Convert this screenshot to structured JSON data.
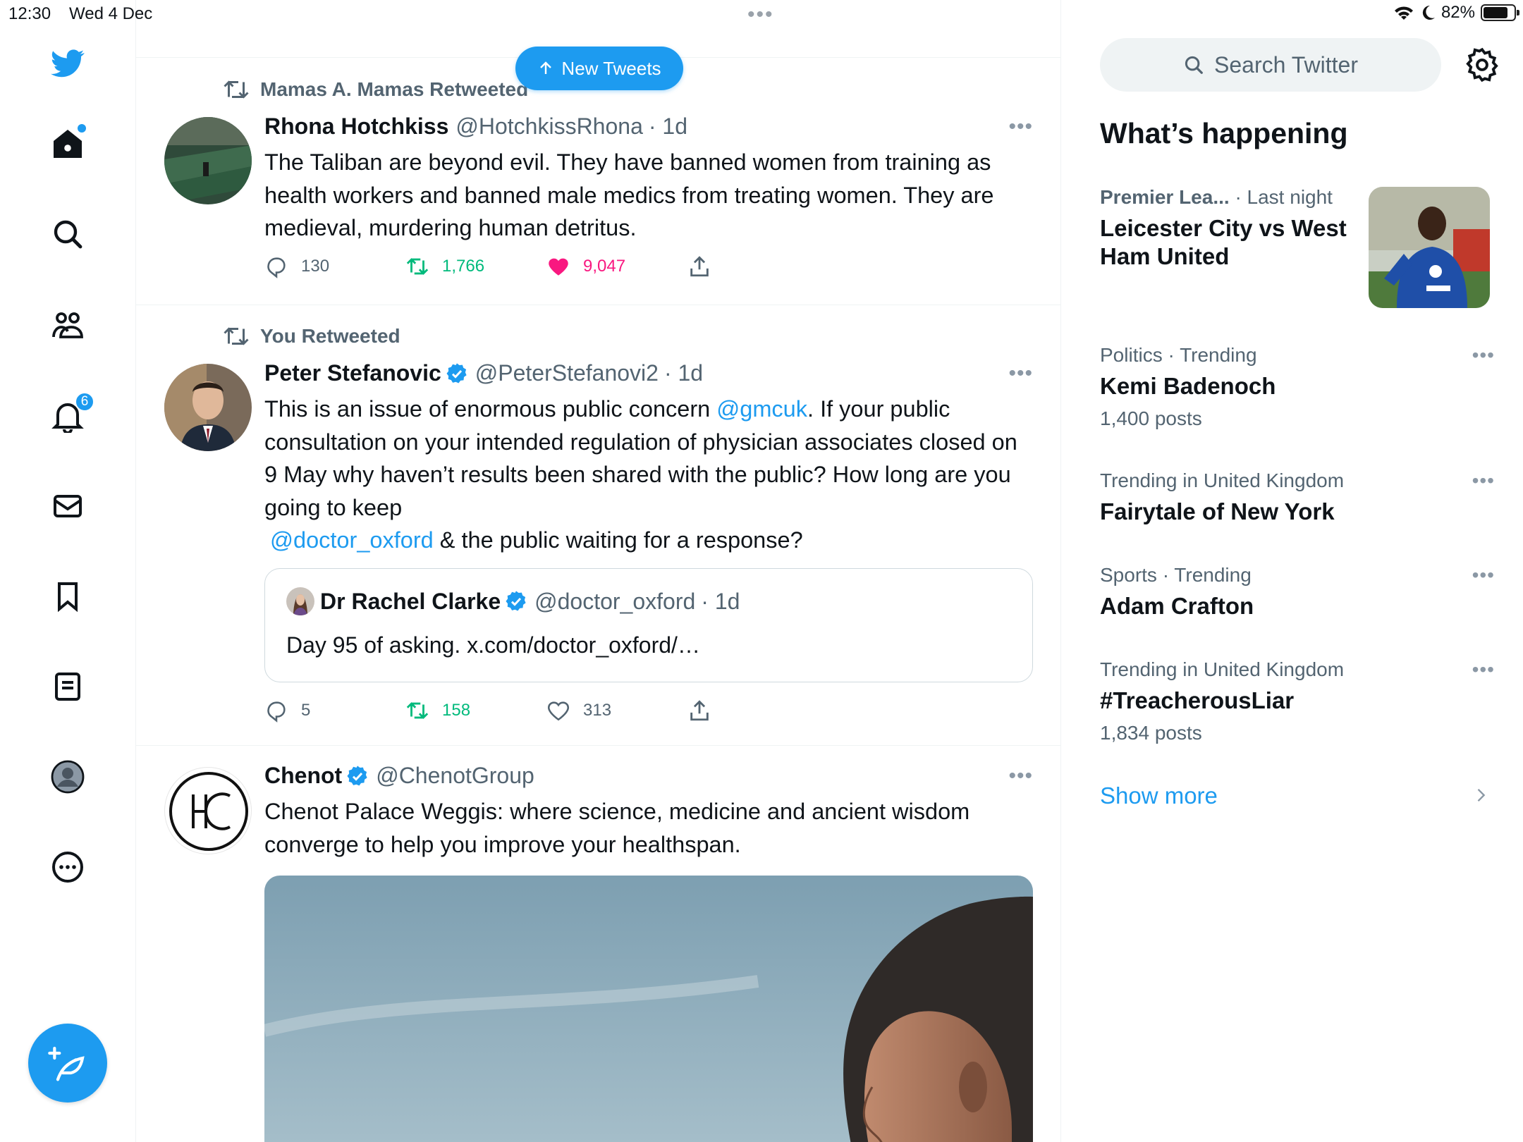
{
  "status_bar": {
    "time": "12:30",
    "date": "Wed 4 Dec",
    "battery": "82%",
    "battery_level": 0.82
  },
  "sidebar": {
    "items": [
      "twitter-logo",
      "home",
      "explore",
      "communities",
      "notifications",
      "messages",
      "bookmarks",
      "lists",
      "profile",
      "more"
    ],
    "notifications_badge": "6",
    "compose_label": "Tweet"
  },
  "timeline": {
    "new_tweets_label": "New Tweets",
    "tweets": [
      {
        "retweeted_by": "Mamas A. Mamas Retweeted",
        "name": "Rhona Hotchkiss",
        "handle": "@HotchkissRhona",
        "time": "· 1d",
        "text": "The Taliban are beyond evil. They have banned women from training as health workers and banned male medics from treating women. They are medieval, murdering human detritus.",
        "replies": "130",
        "retweets": "1,766",
        "likes": "9,047"
      },
      {
        "retweeted_by": "You Retweeted",
        "name": "Peter Stefanovic",
        "handle": "@PeterStefanovi2",
        "time": "· 1d",
        "text_before": "This is an issue of enormous public concern ",
        "mention1": "@gmcuk",
        "text_middle": ". If your public consultation on your intended regulation of physician associates closed on 9 May why haven’t results been shared with the public? How long are you going to keep",
        "mention2": "@doctor_oxford",
        "text_after": " & the public waiting for a response?",
        "quote": {
          "name": "Dr Rachel Clarke",
          "handle": "@doctor_oxford",
          "time": "· 1d",
          "text": "Day 95 of asking. x.com/doctor_oxford/…"
        },
        "replies": "5",
        "retweets": "158",
        "likes": "313"
      },
      {
        "name": "Chenot",
        "handle": "@ChenotGroup",
        "text": "Chenot Palace Weggis: where science, medicine and ancient wisdom converge to help you improve your healthspan."
      }
    ]
  },
  "right_panel": {
    "search_placeholder": "Search Twitter",
    "section_title": "What’s happening",
    "trends": [
      {
        "category": "Premier Lea...",
        "when": "· Last night",
        "title": "Leicester City vs West Ham United"
      },
      {
        "category": "Politics · Trending",
        "title": "Kemi Badenoch",
        "count": "1,400 posts"
      },
      {
        "category": "Trending in United Kingdom",
        "title": "Fairytale of New York"
      },
      {
        "category": "Sports · Trending",
        "title": "Adam Crafton"
      },
      {
        "category": "Trending in United Kingdom",
        "title": "#TreacherousLiar",
        "count": "1,834 posts"
      }
    ],
    "show_more": "Show more"
  },
  "colors": {
    "accent": "#1d9bf0",
    "retweet": "#00ba7c",
    "like": "#f91880",
    "muted": "#536471"
  }
}
